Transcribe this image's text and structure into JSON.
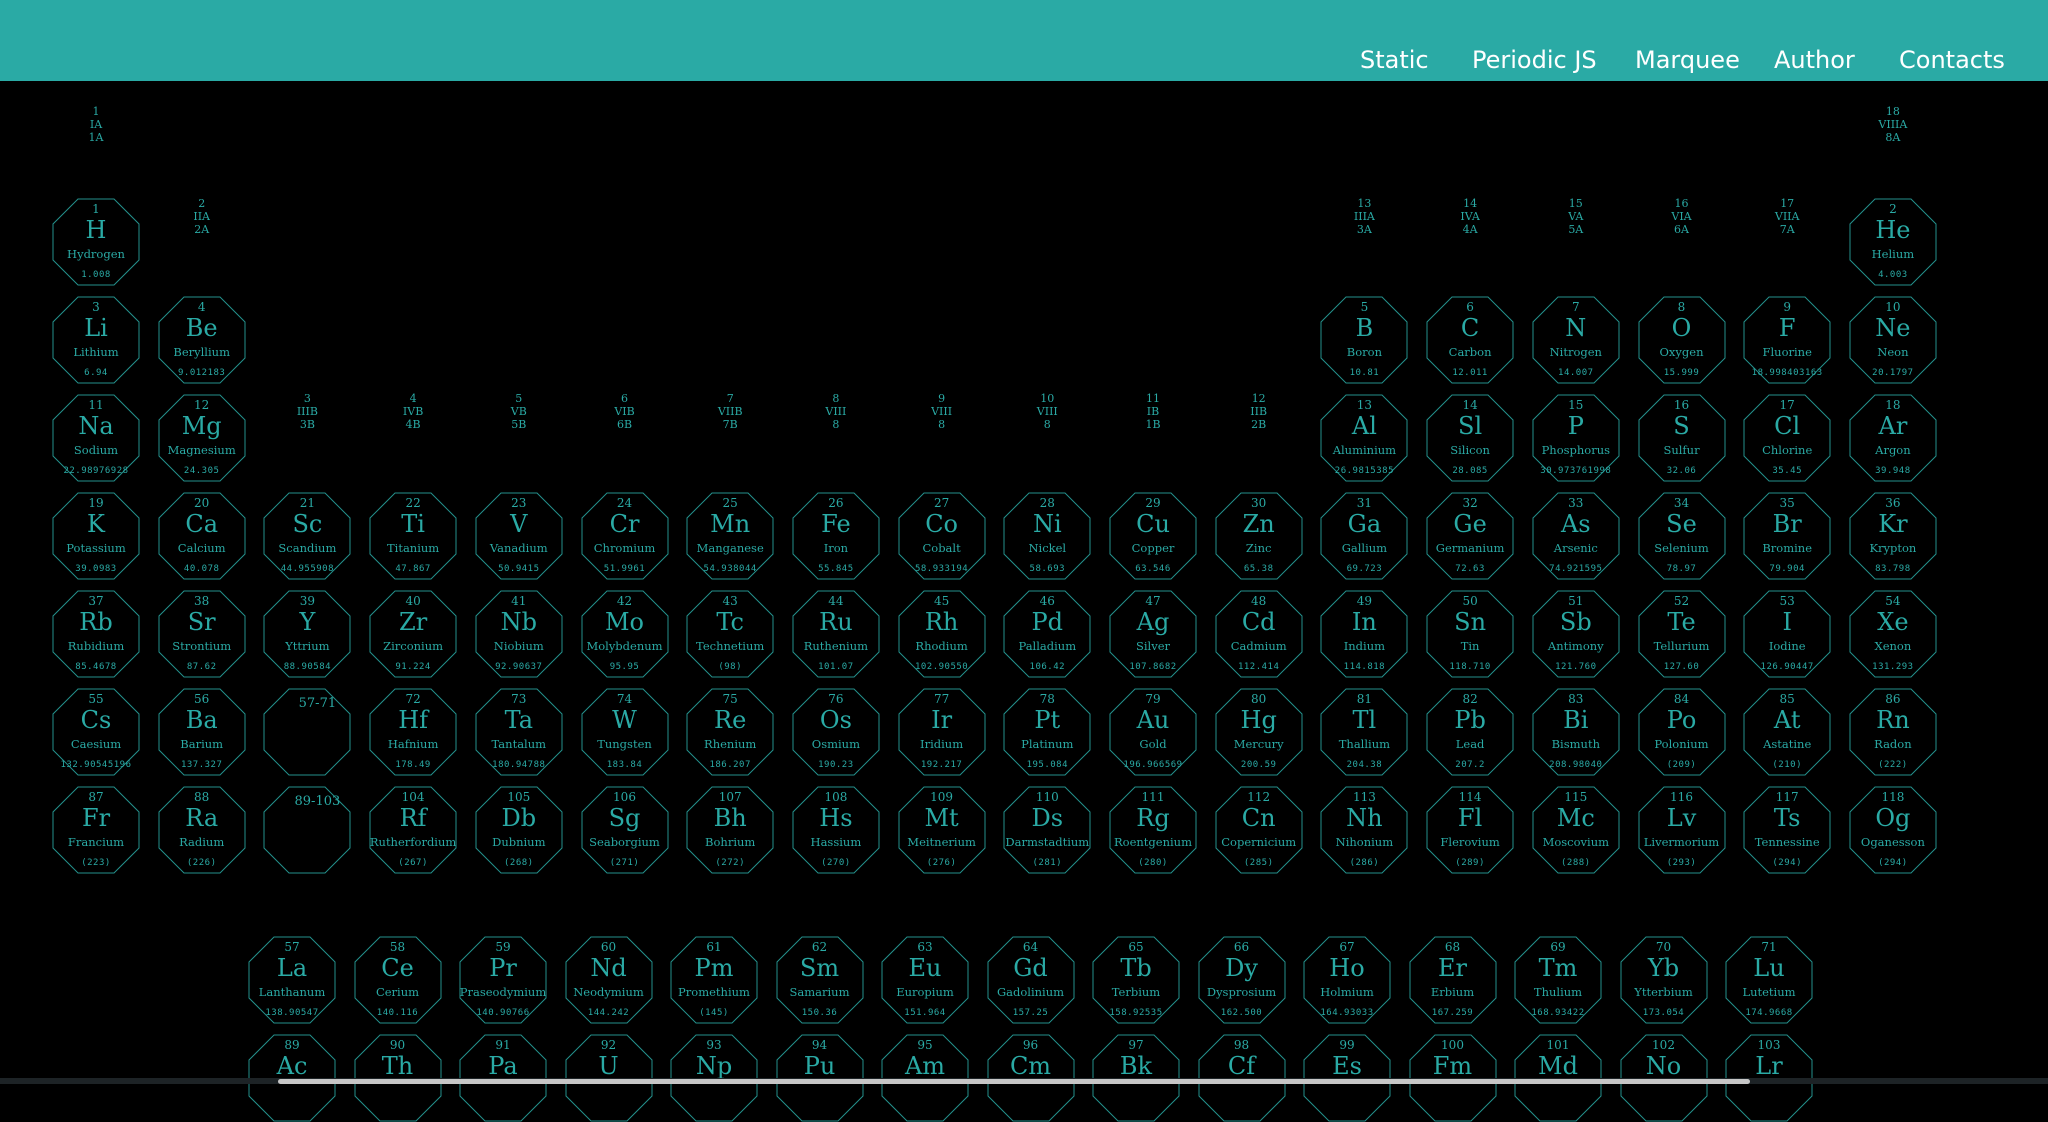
{
  "header": {
    "nav": [
      {
        "label": "Static"
      },
      {
        "label": "Periodic JS"
      },
      {
        "label": "Marquee"
      },
      {
        "label": "Author"
      },
      {
        "label": "Contacts"
      }
    ]
  },
  "colors": {
    "accent": "#2aaaa5",
    "background": "#000000",
    "header": "#2aaaa5"
  },
  "group_labels": [
    [
      "1",
      "IA",
      "1A"
    ],
    [
      "2",
      "IIA",
      "2A"
    ],
    [
      "3",
      "IIIB",
      "3B"
    ],
    [
      "4",
      "IVB",
      "4B"
    ],
    [
      "5",
      "VB",
      "5B"
    ],
    [
      "6",
      "VIB",
      "6B"
    ],
    [
      "7",
      "VIIB",
      "7B"
    ],
    [
      "8",
      "VIII",
      "8"
    ],
    [
      "9",
      "VIII",
      "8"
    ],
    [
      "10",
      "VIII",
      "8"
    ],
    [
      "11",
      "IB",
      "1B"
    ],
    [
      "12",
      "IIB",
      "2B"
    ],
    [
      "13",
      "IIIA",
      "3A"
    ],
    [
      "14",
      "IVA",
      "4A"
    ],
    [
      "15",
      "VA",
      "5A"
    ],
    [
      "16",
      "VIA",
      "6A"
    ],
    [
      "17",
      "VIIA",
      "7A"
    ],
    [
      "18",
      "VIIIA",
      "8A"
    ]
  ],
  "elements": [
    [
      "1",
      "H",
      "Hydrogen",
      "1.008"
    ],
    [
      "2",
      "He",
      "Helium",
      "4.003"
    ],
    [
      "3",
      "Li",
      "Lithium",
      "6.94"
    ],
    [
      "4",
      "Be",
      "Beryllium",
      "9.012183"
    ],
    [
      "5",
      "B",
      "Boron",
      "10.81"
    ],
    [
      "6",
      "C",
      "Carbon",
      "12.011"
    ],
    [
      "7",
      "N",
      "Nitrogen",
      "14.007"
    ],
    [
      "8",
      "O",
      "Oxygen",
      "15.999"
    ],
    [
      "9",
      "F",
      "Fluorine",
      "18.998403163"
    ],
    [
      "10",
      "Ne",
      "Neon",
      "20.1797"
    ],
    [
      "11",
      "Na",
      "Sodium",
      "22.98976928"
    ],
    [
      "12",
      "Mg",
      "Magnesium",
      "24.305"
    ],
    [
      "13",
      "Al",
      "Aluminium",
      "26.9815385"
    ],
    [
      "14",
      "Sl",
      "Silicon",
      "28.085"
    ],
    [
      "15",
      "P",
      "Phosphorus",
      "30.973761998"
    ],
    [
      "16",
      "S",
      "Sulfur",
      "32.06"
    ],
    [
      "17",
      "Cl",
      "Chlorine",
      "35.45"
    ],
    [
      "18",
      "Ar",
      "Argon",
      "39.948"
    ],
    [
      "19",
      "K",
      "Potassium",
      "39.0983"
    ],
    [
      "20",
      "Ca",
      "Calcium",
      "40.078"
    ],
    [
      "21",
      "Sc",
      "Scandium",
      "44.955908"
    ],
    [
      "22",
      "Ti",
      "Titanium",
      "47.867"
    ],
    [
      "23",
      "V",
      "Vanadium",
      "50.9415"
    ],
    [
      "24",
      "Cr",
      "Chromium",
      "51.9961"
    ],
    [
      "25",
      "Mn",
      "Manganese",
      "54.938044"
    ],
    [
      "26",
      "Fe",
      "Iron",
      "55.845"
    ],
    [
      "27",
      "Co",
      "Cobalt",
      "58.933194"
    ],
    [
      "28",
      "Ni",
      "Nickel",
      "58.693"
    ],
    [
      "29",
      "Cu",
      "Copper",
      "63.546"
    ],
    [
      "30",
      "Zn",
      "Zinc",
      "65.38"
    ],
    [
      "31",
      "Ga",
      "Gallium",
      "69.723"
    ],
    [
      "32",
      "Ge",
      "Germanium",
      "72.63"
    ],
    [
      "33",
      "As",
      "Arsenic",
      "74.921595"
    ],
    [
      "34",
      "Se",
      "Selenium",
      "78.97"
    ],
    [
      "35",
      "Br",
      "Bromine",
      "79.904"
    ],
    [
      "36",
      "Kr",
      "Krypton",
      "83.798"
    ],
    [
      "37",
      "Rb",
      "Rubidium",
      "85.4678"
    ],
    [
      "38",
      "Sr",
      "Strontium",
      "87.62"
    ],
    [
      "39",
      "Y",
      "Yttrium",
      "88.90584"
    ],
    [
      "40",
      "Zr",
      "Zirconium",
      "91.224"
    ],
    [
      "41",
      "Nb",
      "Niobium",
      "92.90637"
    ],
    [
      "42",
      "Mo",
      "Molybdenum",
      "95.95"
    ],
    [
      "43",
      "Tc",
      "Technetium",
      "(98)"
    ],
    [
      "44",
      "Ru",
      "Ruthenium",
      "101.07"
    ],
    [
      "45",
      "Rh",
      "Rhodium",
      "102.90550"
    ],
    [
      "46",
      "Pd",
      "Palladium",
      "106.42"
    ],
    [
      "47",
      "Ag",
      "Silver",
      "107.8682"
    ],
    [
      "48",
      "Cd",
      "Cadmium",
      "112.414"
    ],
    [
      "49",
      "In",
      "Indium",
      "114.818"
    ],
    [
      "50",
      "Sn",
      "Tin",
      "118.710"
    ],
    [
      "51",
      "Sb",
      "Antimony",
      "121.760"
    ],
    [
      "52",
      "Te",
      "Tellurium",
      "127.60"
    ],
    [
      "53",
      "I",
      "Iodine",
      "126.90447"
    ],
    [
      "54",
      "Xe",
      "Xenon",
      "131.293"
    ],
    [
      "55",
      "Cs",
      "Caesium",
      "132.90545196"
    ],
    [
      "56",
      "Ba",
      "Barium",
      "137.327"
    ],
    [
      "57-71",
      "",
      "",
      ""
    ],
    [
      "72",
      "Hf",
      "Hafnium",
      "178.49"
    ],
    [
      "73",
      "Ta",
      "Tantalum",
      "180.94788"
    ],
    [
      "74",
      "W",
      "Tungsten",
      "183.84"
    ],
    [
      "75",
      "Re",
      "Rhenium",
      "186.207"
    ],
    [
      "76",
      "Os",
      "Osmium",
      "190.23"
    ],
    [
      "77",
      "Ir",
      "Iridium",
      "192.217"
    ],
    [
      "78",
      "Pt",
      "Platinum",
      "195.084"
    ],
    [
      "79",
      "Au",
      "Gold",
      "196.966569"
    ],
    [
      "80",
      "Hg",
      "Mercury",
      "200.59"
    ],
    [
      "81",
      "Tl",
      "Thallium",
      "204.38"
    ],
    [
      "82",
      "Pb",
      "Lead",
      "207.2"
    ],
    [
      "83",
      "Bi",
      "Bismuth",
      "208.98040"
    ],
    [
      "84",
      "Po",
      "Polonium",
      "(209)"
    ],
    [
      "85",
      "At",
      "Astatine",
      "(210)"
    ],
    [
      "86",
      "Rn",
      "Radon",
      "(222)"
    ],
    [
      "87",
      "Fr",
      "Francium",
      "(223)"
    ],
    [
      "88",
      "Ra",
      "Radium",
      "(226)"
    ],
    [
      "89-103",
      "",
      "",
      ""
    ],
    [
      "104",
      "Rf",
      "Rutherfordium",
      "(267)"
    ],
    [
      "105",
      "Db",
      "Dubnium",
      "(268)"
    ],
    [
      "106",
      "Sg",
      "Seaborgium",
      "(271)"
    ],
    [
      "107",
      "Bh",
      "Bohrium",
      "(272)"
    ],
    [
      "108",
      "Hs",
      "Hassium",
      "(270)"
    ],
    [
      "109",
      "Mt",
      "Meitnerium",
      "(276)"
    ],
    [
      "110",
      "Ds",
      "Darmstadtium",
      "(281)"
    ],
    [
      "111",
      "Rg",
      "Roentgenium",
      "(280)"
    ],
    [
      "112",
      "Cn",
      "Copernicium",
      "(285)"
    ],
    [
      "113",
      "Nh",
      "Nihonium",
      "(286)"
    ],
    [
      "114",
      "Fl",
      "Flerovium",
      "(289)"
    ],
    [
      "115",
      "Mc",
      "Moscovium",
      "(288)"
    ],
    [
      "116",
      "Lv",
      "Livermorium",
      "(293)"
    ],
    [
      "117",
      "Ts",
      "Tennessine",
      "(294)"
    ],
    [
      "118",
      "Og",
      "Oganesson",
      "(294)"
    ],
    [
      "57",
      "La",
      "Lanthanum",
      "138.90547"
    ],
    [
      "58",
      "Ce",
      "Cerium",
      "140.116"
    ],
    [
      "59",
      "Pr",
      "Praseodymium",
      "140.90766"
    ],
    [
      "60",
      "Nd",
      "Neodymium",
      "144.242"
    ],
    [
      "61",
      "Pm",
      "Promethium",
      "(145)"
    ],
    [
      "62",
      "Sm",
      "Samarium",
      "150.36"
    ],
    [
      "63",
      "Eu",
      "Europium",
      "151.964"
    ],
    [
      "64",
      "Gd",
      "Gadolinium",
      "157.25"
    ],
    [
      "65",
      "Tb",
      "Terbium",
      "158.92535"
    ],
    [
      "66",
      "Dy",
      "Dysprosium",
      "162.500"
    ],
    [
      "67",
      "Ho",
      "Holmium",
      "164.93033"
    ],
    [
      "68",
      "Er",
      "Erbium",
      "167.259"
    ],
    [
      "69",
      "Tm",
      "Thulium",
      "168.93422"
    ],
    [
      "70",
      "Yb",
      "Ytterbium",
      "173.054"
    ],
    [
      "71",
      "Lu",
      "Lutetium",
      "174.9668"
    ],
    [
      "89",
      "Ac",
      "",
      ""
    ],
    [
      "90",
      "Th",
      "",
      ""
    ],
    [
      "91",
      "Pa",
      "",
      ""
    ],
    [
      "92",
      "U",
      "",
      ""
    ],
    [
      "93",
      "Np",
      "",
      ""
    ],
    [
      "94",
      "Pu",
      "",
      ""
    ],
    [
      "95",
      "Am",
      "",
      ""
    ],
    [
      "96",
      "Cm",
      "",
      ""
    ],
    [
      "97",
      "Bk",
      "",
      ""
    ],
    [
      "98",
      "Cf",
      "",
      ""
    ],
    [
      "99",
      "Es",
      "",
      ""
    ],
    [
      "100",
      "Fm",
      "",
      ""
    ],
    [
      "101",
      "Md",
      "",
      ""
    ],
    [
      "102",
      "No",
      "",
      ""
    ],
    [
      "103",
      "Lr",
      "",
      ""
    ]
  ]
}
